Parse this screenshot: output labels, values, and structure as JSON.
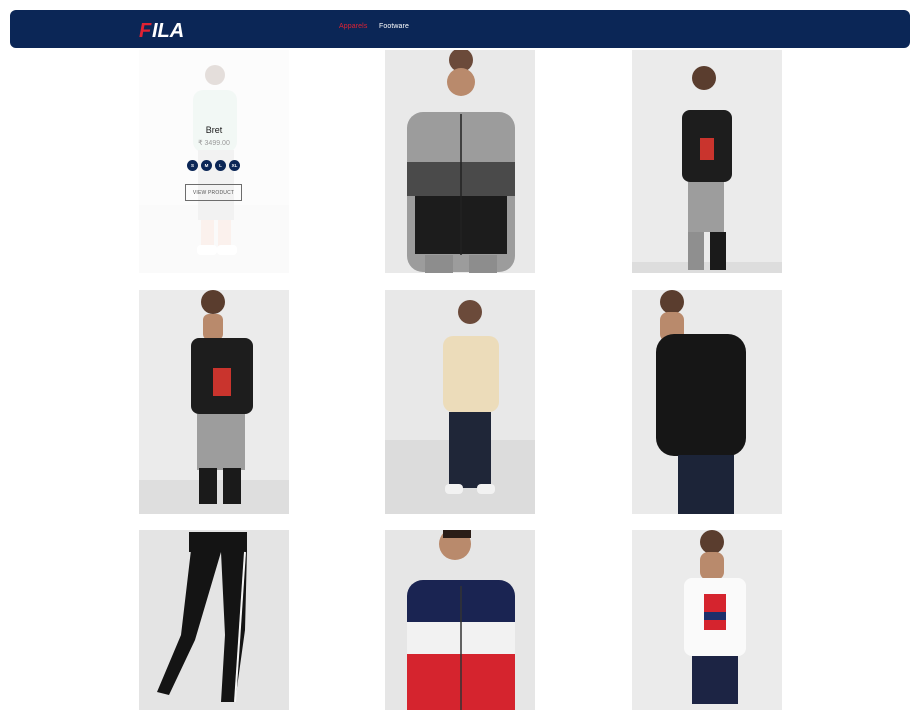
{
  "header": {
    "brand": "FILA",
    "nav": [
      {
        "label": "Apparels",
        "active": true
      },
      {
        "label": "Footware",
        "active": false
      }
    ],
    "colors": {
      "bar": "#0b2656",
      "accent": "#e02233"
    }
  },
  "hover_card": {
    "name": "Bret",
    "price": "₹ 3499.00",
    "sizes": [
      "S",
      "M",
      "L",
      "XL"
    ],
    "button": "VIEW PRODUCT"
  },
  "products": [
    {
      "item": "light hoodie and trousers",
      "icon": "product-photo"
    },
    {
      "item": "grey and black zip hoodie",
      "icon": "product-photo"
    },
    {
      "item": "black t-shirt and joggers",
      "icon": "product-photo"
    },
    {
      "item": "black t-shirt and grey joggers",
      "icon": "product-photo"
    },
    {
      "item": "beige fleece jacket and jeans",
      "icon": "product-photo"
    },
    {
      "item": "black zip hoodie",
      "icon": "product-photo"
    },
    {
      "item": "black track pants",
      "icon": "product-photo"
    },
    {
      "item": "navy white red zip hoodie",
      "icon": "product-photo"
    },
    {
      "item": "white graphic t-shirt and shorts",
      "icon": "product-photo"
    }
  ]
}
